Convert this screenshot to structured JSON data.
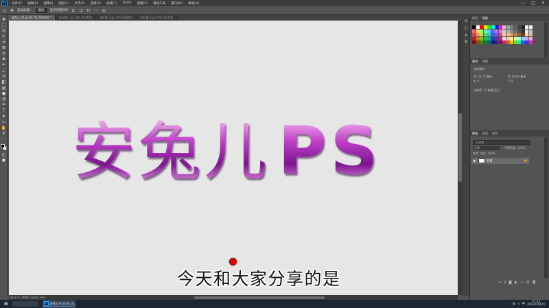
{
  "app": {
    "logo": "Ps",
    "menus": [
      "文件(F)",
      "编辑(E)",
      "图像(I)",
      "图层(L)",
      "文字(Y)",
      "选择(S)",
      "滤镜(T)",
      "3D(D)",
      "视图(V)",
      "增效工具",
      "窗口(W)",
      "帮助(H)"
    ],
    "window_controls": [
      "—",
      "□",
      "✕"
    ]
  },
  "options_bar": {
    "home_icon": "home-icon",
    "tool_icon": "move-tool-icon",
    "auto_select_label": "自动选择：",
    "auto_select_value": "图层",
    "show_transform_label": "显示变换控件"
  },
  "document_tabs": [
    {
      "label": "安兔儿 PS @ 66.7% (RGB/8) *",
      "active": true
    },
    {
      "label": "未标题-1 @ 50% (RGB/8)",
      "active": false
    },
    {
      "label": "未标题-2 @ 50% (RGB/8)",
      "active": false
    },
    {
      "label": "未标题-3 @ 50% (RGB/8)",
      "active": false
    }
  ],
  "tools": [
    "move-tool-icon",
    "marquee-tool-icon",
    "lasso-tool-icon",
    "quick-select-icon",
    "crop-tool-icon",
    "frame-tool-icon",
    "eyedropper-icon",
    "healing-brush-icon",
    "brush-tool-icon",
    "clone-stamp-icon",
    "history-brush-icon",
    "eraser-icon",
    "gradient-tool-icon",
    "blur-tool-icon",
    "dodge-tool-icon",
    "pen-tool-icon",
    "type-tool-icon",
    "path-select-icon",
    "shape-tool-icon",
    "hand-tool-icon",
    "zoom-tool-icon",
    "more-tools-icon"
  ],
  "canvas": {
    "art_text": "安兔儿",
    "art_text_latin": "PS",
    "subtitle": "今天和大家分享的是"
  },
  "status_bar": {
    "zoom": "66.67%",
    "doc_info": "文档:1.39M/2.45M"
  },
  "right_panel": {
    "swatches_tabs": [
      "颜色",
      "色板"
    ],
    "swatch_colors": [
      "#000000",
      "#ffffff",
      "#ff0000",
      "#ffff00",
      "#00ff00",
      "#00ffff",
      "#0000ff",
      "#ff00ff",
      "#c8c8c8",
      "#a0a0a0",
      "#808080",
      "#606060",
      "#404040",
      "#202020",
      "#ffffff",
      "#f0f0f0",
      "#ff6666",
      "#ffcc66",
      "#99ff66",
      "#66ffcc",
      "#66ccff",
      "#6666ff",
      "#cc66ff",
      "#ff66cc",
      "#d0d0d0",
      "#b0b0b0",
      "#909090",
      "#707070",
      "#505050",
      "#303030",
      "#e8e8e8",
      "#c0c0c0",
      "#e84040",
      "#e8a040",
      "#c8e040",
      "#40e080",
      "#40c0e8",
      "#4060e8",
      "#a040e8",
      "#e040a0",
      "#f4d0b0",
      "#e8c090",
      "#d4a070",
      "#b08050",
      "#906040",
      "#704020",
      "#f0e0c0",
      "#d8c0a0",
      "#c02020",
      "#c08020",
      "#80c020",
      "#20c060",
      "#20a0c0",
      "#2040c0",
      "#8020c0",
      "#c02080",
      "#ffe0e0",
      "#ffd0a0",
      "#fff0a0",
      "#d0ffa0",
      "#a0ffe0",
      "#a0d0ff",
      "#d0a0ff",
      "#ffa0d0",
      "#801010",
      "#805010",
      "#508010",
      "#108040",
      "#106080",
      "#102080",
      "#501080",
      "#801050",
      "#e02060",
      "#e06020",
      "#e0c020",
      "#60e020",
      "#20e0c0",
      "#2060e0",
      "#6020e0",
      "#e020c0"
    ],
    "properties_tabs": [
      "属性",
      "调整"
    ],
    "properties_title": "文档属性",
    "width_label": "W: 26.75 厘米",
    "height_label": "H: 16.93 厘米",
    "x_label": "X: 0",
    "y_label": "Y: 0",
    "resolution": "分辨率: 72 像素/英寸",
    "layers_tabs": [
      "图层",
      "通道",
      "路径"
    ],
    "layers_filter": "Q 类型",
    "blend_mode": "正常",
    "opacity": "不透明度: 100%",
    "lock_row": "锁定:  填充: 100%",
    "layer_name": "背景",
    "layer_lock_icon": "lock-icon",
    "footer_icons": [
      "link-icon",
      "fx-icon",
      "mask-icon",
      "adjustment-icon",
      "folder-icon",
      "new-layer-icon",
      "trash-icon"
    ]
  },
  "taskbar": {
    "start_icon": "windows-icon",
    "ps_task_label": "安兔儿 PS @ 66.7%...",
    "tray_icons": [
      "chevron-up-icon",
      "network-icon",
      "volume-icon",
      "ime-icon"
    ],
    "time": "15:12",
    "date": "2022/10/24"
  }
}
